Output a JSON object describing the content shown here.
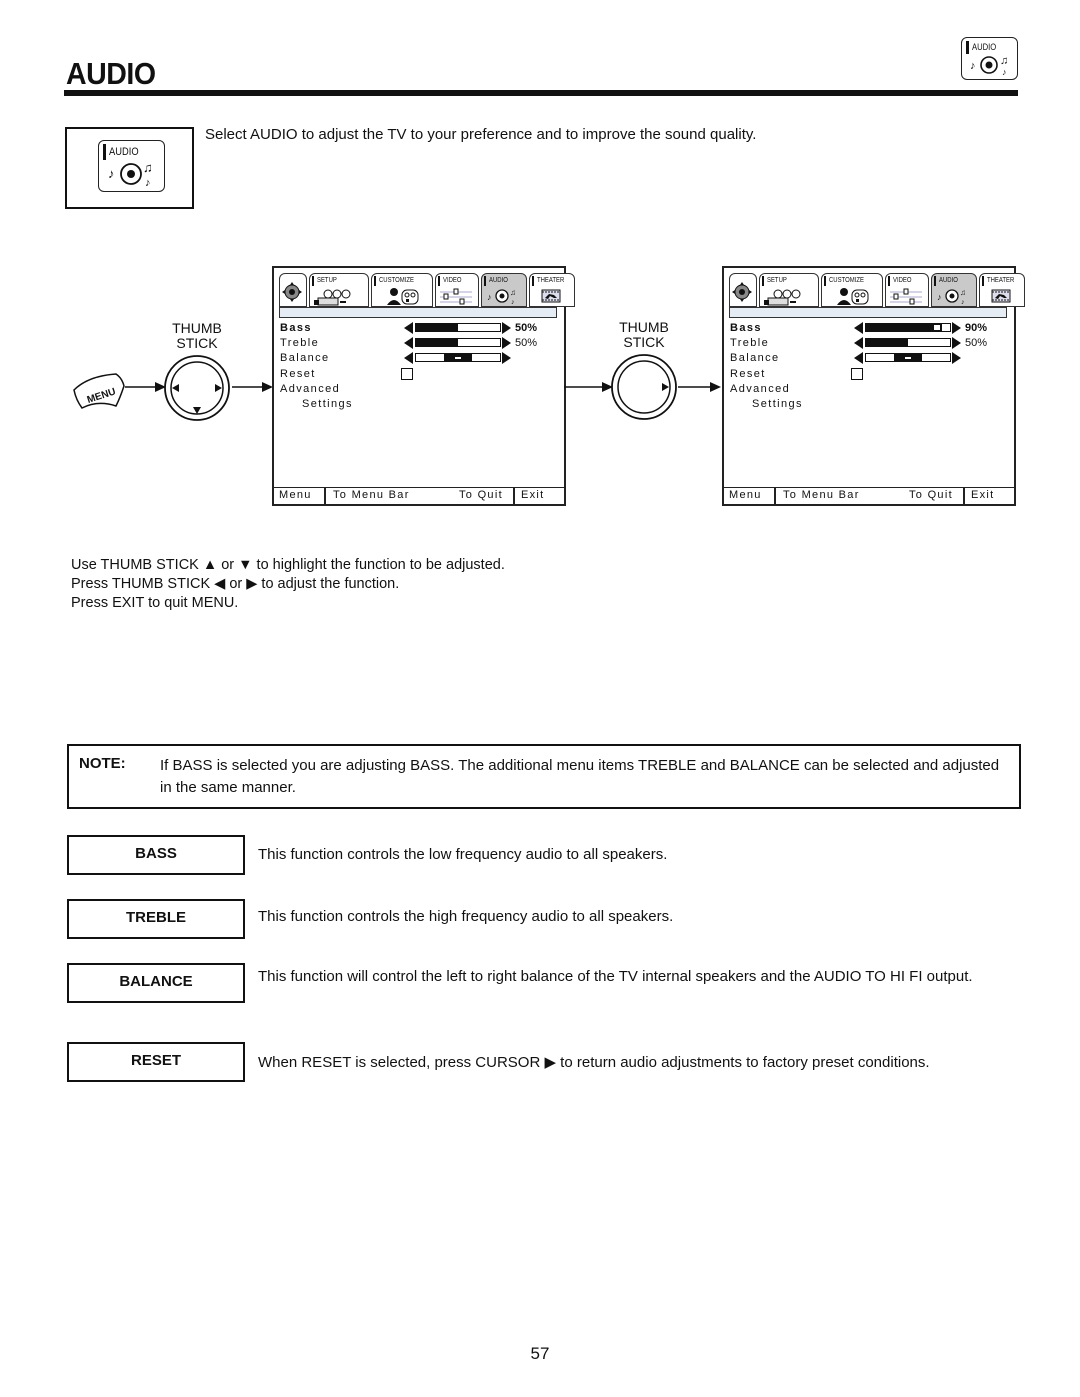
{
  "page": {
    "title": "AUDIO",
    "page_number": "57"
  },
  "header_icon": {
    "label": "AUDIO",
    "icon": "audio-disc-icon"
  },
  "intro": {
    "icon_label": "AUDIO",
    "text": "Select AUDIO to adjust the TV to your preference and to improve the sound quality."
  },
  "diagram": {
    "menu_button_label": "MENU",
    "thumb_stick_label_line1": "THUMB",
    "thumb_stick_label_line2": "STICK",
    "tabs": [
      {
        "label": "",
        "icon": "thumb-stick-icon"
      },
      {
        "label": "SETUP",
        "icon": "camera-setup-icon"
      },
      {
        "label": "CUSTOMIZE",
        "icon": "person-customize-icon"
      },
      {
        "label": "VIDEO",
        "icon": "video-sliders-icon"
      },
      {
        "label": "AUDIO",
        "icon": "audio-disc-icon"
      },
      {
        "label": "THEATER",
        "icon": "theater-film-icon"
      }
    ],
    "screens": [
      {
        "active_tab": "AUDIO",
        "items": [
          {
            "label": "Bass",
            "selected": true,
            "type": "slider",
            "value_pct": 50,
            "value_text": "50%"
          },
          {
            "label": "Treble",
            "selected": false,
            "type": "slider",
            "value_pct": 50,
            "value_text": "50%"
          },
          {
            "label": "Balance",
            "selected": false,
            "type": "balance",
            "value_pct": 50
          },
          {
            "label": "Reset",
            "selected": false,
            "type": "checkbox"
          },
          {
            "label": "Advanced",
            "selected": false,
            "type": "text"
          },
          {
            "label": "Settings",
            "selected": false,
            "type": "text"
          }
        ],
        "footer": {
          "menu": "Menu",
          "to_menu_bar": "To Menu Bar",
          "to_quit": "To Quit",
          "exit": "Exit"
        }
      },
      {
        "active_tab": "AUDIO",
        "items": [
          {
            "label": "Bass",
            "selected": true,
            "type": "slider",
            "value_pct": 90,
            "value_text": "90%"
          },
          {
            "label": "Treble",
            "selected": false,
            "type": "slider",
            "value_pct": 50,
            "value_text": "50%"
          },
          {
            "label": "Balance",
            "selected": false,
            "type": "balance",
            "value_pct": 50
          },
          {
            "label": "Reset",
            "selected": false,
            "type": "checkbox"
          },
          {
            "label": "Advanced",
            "selected": false,
            "type": "text"
          },
          {
            "label": "Settings",
            "selected": false,
            "type": "text"
          }
        ],
        "footer": {
          "menu": "Menu",
          "to_menu_bar": "To Menu Bar",
          "to_quit": "To Quit",
          "exit": "Exit"
        }
      }
    ]
  },
  "instructions": [
    {
      "pre": "Use THUMB STICK ",
      "sym1": "▲",
      "mid": " or ",
      "sym2": "▼",
      "post": " to highlight the function to be adjusted."
    },
    {
      "pre": "Press THUMB STICK ",
      "sym1": "◀",
      "mid": " or ",
      "sym2": "▶",
      "post": " to adjust the function."
    },
    {
      "pre": "Press EXIT to quit MENU.",
      "sym1": "",
      "mid": "",
      "sym2": "",
      "post": ""
    }
  ],
  "note": {
    "heading": "NOTE:",
    "text": "If BASS is selected you are adjusting BASS.  The additional menu items TREBLE and BALANCE can be selected and adjusted in the same manner."
  },
  "functions": [
    {
      "name": "BASS",
      "description": "This function controls the low frequency audio to all speakers."
    },
    {
      "name": "TREBLE",
      "description": "This function controls the high frequency audio to all speakers."
    },
    {
      "name": "BALANCE",
      "description": "This function will control the left to right balance of the TV internal speakers and the AUDIO TO HI FI output."
    },
    {
      "name": "RESET",
      "description": "When RESET is selected, press CURSOR ▶ to return audio adjustments to factory preset conditions."
    }
  ]
}
